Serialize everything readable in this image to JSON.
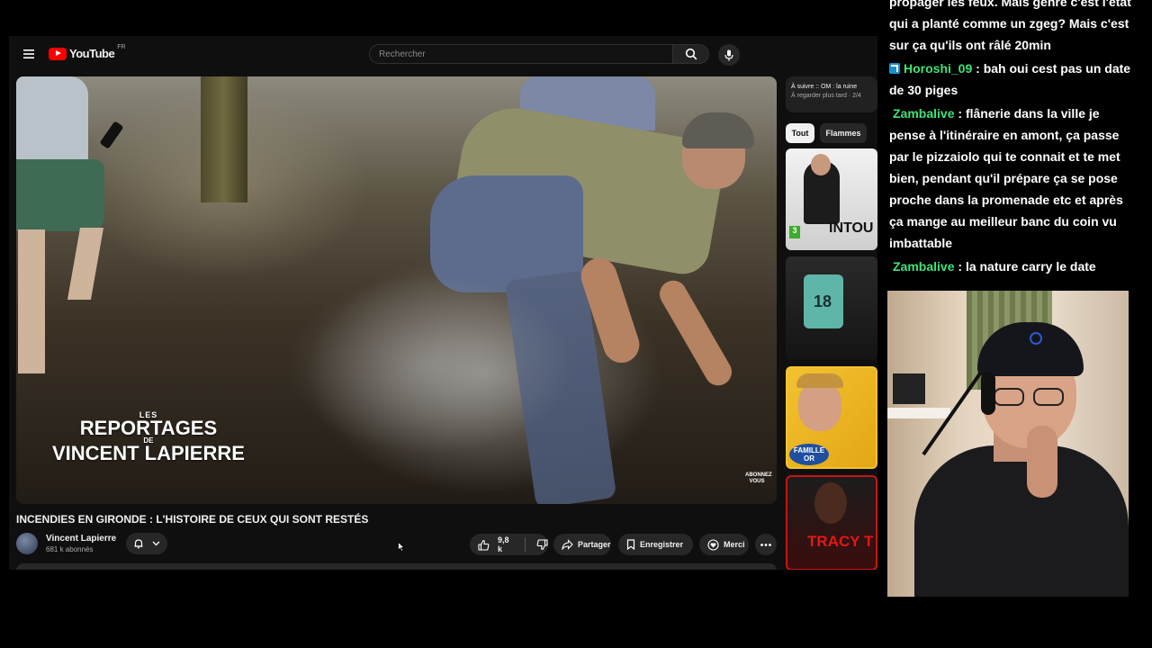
{
  "youtube": {
    "logo_text": "YouTube",
    "country_code": "FR",
    "search_placeholder": "Rechercher",
    "video": {
      "title": "INCENDIES EN GIRONDE : L'HISTOIRE DE CEUX QUI SONT RESTÉS",
      "watermark": {
        "line1": "LES",
        "line2": "REPORTAGES",
        "line3": "DE",
        "line4": "VINCENT LAPIERRE"
      },
      "corner_badge": "ABONNEZ VOUS"
    },
    "channel": {
      "name": "Vincent Lapierre",
      "subscribers": "681 k abonnés"
    },
    "actions": {
      "likes": "9,8 k",
      "share_label": "Partager",
      "save_label": "Enregistrer",
      "thanks_label": "Merci"
    },
    "up_next": {
      "title": "À suivre :: OM : la ruine",
      "subtitle": "À regarder plus tard · 2/4"
    },
    "chips": [
      "Tout",
      "Flammes"
    ],
    "thumbnails": [
      {
        "title": "INTOU",
        "badge": "3"
      },
      {
        "title": "18"
      },
      {
        "title": "FAMILLE OR"
      },
      {
        "title": "TRACY T"
      }
    ]
  },
  "chat": {
    "messages": [
      {
        "user": "",
        "text": "propager les feux. Mais genre c'est l'état qui a planté comme un zgeg? Mais c'est sur ça qu'ils ont râlé 20min"
      },
      {
        "user": "Horoshi_09",
        "badge": true,
        "text": "bah oui cest pas un date de 30 piges"
      },
      {
        "user": "Zambalive",
        "text": "flânerie dans la ville je pense à l'itinéraire en amont, ça passe par le pizzaiolo qui te connait et te met bien, pendant qu'il prépare ça se pose proche dans la promenade etc et après ça mange au meilleur banc du coin vu imbattable"
      },
      {
        "user": "Zambalive",
        "text": "la nature carry le date"
      }
    ],
    "separator": " : "
  },
  "colors": {
    "user": "#3ee37a",
    "youtube_red": "#ff0000",
    "bg": "#0f0f0f"
  }
}
